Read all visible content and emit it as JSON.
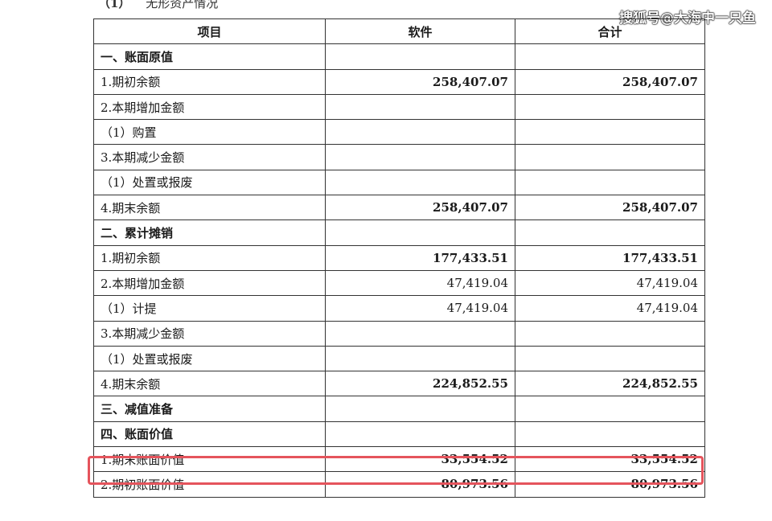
{
  "section": {
    "number": "（1）",
    "title": "无形资产情况"
  },
  "watermark": "搜狐号@大海中一只鱼",
  "table": {
    "headers": [
      "项目",
      "软件",
      "合计"
    ],
    "rows": [
      {
        "label": "一、账面原值",
        "software": "",
        "total": "",
        "bold_label": true,
        "bold_values": false
      },
      {
        "label": "1.期初余额",
        "software": "258,407.07",
        "total": "258,407.07",
        "bold_label": false,
        "bold_values": true
      },
      {
        "label": "2.本期增加金额",
        "software": "",
        "total": "",
        "bold_label": false,
        "bold_values": false
      },
      {
        "label": "（1）购置",
        "software": "",
        "total": "",
        "bold_label": false,
        "bold_values": false
      },
      {
        "label": "3.本期减少金额",
        "software": "",
        "total": "",
        "bold_label": false,
        "bold_values": false
      },
      {
        "label": "（1）处置或报废",
        "software": "",
        "total": "",
        "bold_label": false,
        "bold_values": false
      },
      {
        "label": "4.期末余额",
        "software": "258,407.07",
        "total": "258,407.07",
        "bold_label": false,
        "bold_values": true
      },
      {
        "label": "二、累计摊销",
        "software": "",
        "total": "",
        "bold_label": true,
        "bold_values": false
      },
      {
        "label": "1.期初余额",
        "software": "177,433.51",
        "total": "177,433.51",
        "bold_label": false,
        "bold_values": true
      },
      {
        "label": "2.本期增加金额",
        "software": "47,419.04",
        "total": "47,419.04",
        "bold_label": false,
        "bold_values": false
      },
      {
        "label": "（1）计提",
        "software": "47,419.04",
        "total": "47,419.04",
        "bold_label": false,
        "bold_values": false
      },
      {
        "label": "3.本期减少金额",
        "software": "",
        "total": "",
        "bold_label": false,
        "bold_values": false
      },
      {
        "label": "（1）处置或报废",
        "software": "",
        "total": "",
        "bold_label": false,
        "bold_values": false
      },
      {
        "label": "4.期末余额",
        "software": "224,852.55",
        "total": "224,852.55",
        "bold_label": false,
        "bold_values": true
      },
      {
        "label": "三、减值准备",
        "software": "",
        "total": "",
        "bold_label": true,
        "bold_values": false
      },
      {
        "label": "四、账面价值",
        "software": "",
        "total": "",
        "bold_label": true,
        "bold_values": false
      },
      {
        "label": "1.期末账面价值",
        "software": "33,554.52",
        "total": "33,554.52",
        "bold_label": false,
        "bold_values": true
      },
      {
        "label": "2.期初账面价值",
        "software": "80,973.56",
        "total": "80,973.56",
        "bold_label": false,
        "bold_values": true
      }
    ]
  },
  "highlight": {
    "row_label": "1.期末账面价值",
    "color": "#e5545c"
  }
}
